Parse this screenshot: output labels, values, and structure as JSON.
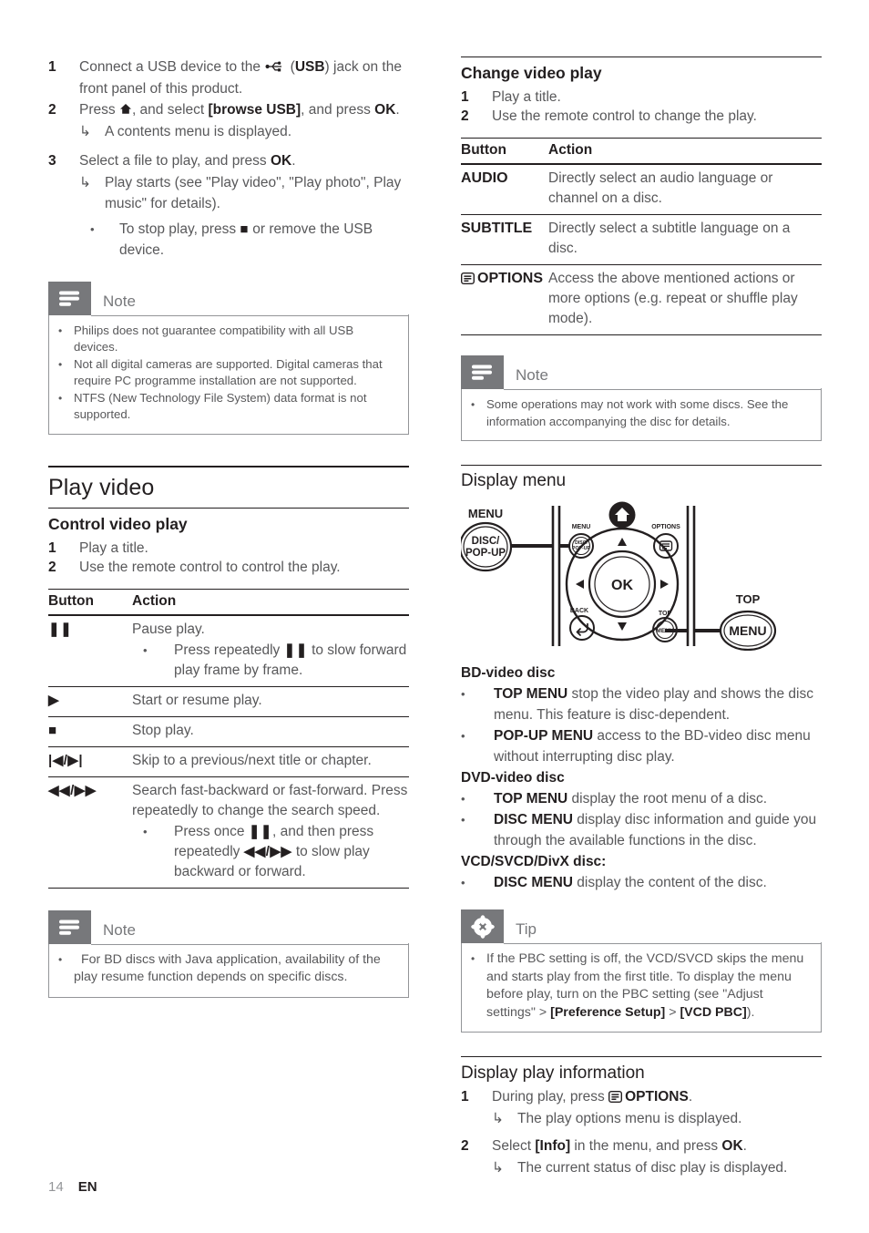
{
  "footer": {
    "page_number": "14",
    "language": "EN"
  },
  "left_column": {
    "usb_steps": [
      {
        "num": "1",
        "text_before": "Connect a USB device to the ",
        "icon": "usb-icon",
        "text_mid": " (",
        "bold": "USB",
        "text_after": ") jack on the front panel of this product."
      },
      {
        "num": "2",
        "text_before": "Press ",
        "icon": "home-icon",
        "text_mid": ", and select ",
        "bold": "[browse USB]",
        "text_after": ", and press ",
        "bold2": "OK",
        "text_end": ".",
        "arrow_note": "A contents menu is displayed."
      },
      {
        "num": "3",
        "text_before": "Select a file to play, and press ",
        "bold": "OK",
        "text_end": ".",
        "arrow_note": "Play starts (see \"Play video\", \"Play photo\", Play music\" for details).",
        "dot_note_before": "To stop play, press ",
        "dot_note_icon": "stop-icon",
        "dot_note_after": " or remove the USB device."
      }
    ],
    "note_usb": {
      "title": "Note",
      "icon": "note-icon",
      "items": [
        "Philips does not guarantee compatibility with all USB devices.",
        "Not all digital cameras are supported. Digital cameras that require PC programme installation are not supported.",
        "NTFS (New Technology File System) data format is not supported."
      ]
    },
    "play_video_heading": "Play video",
    "control_video_play": {
      "heading": "Control video play",
      "steps": [
        {
          "num": "1",
          "text": "Play a title."
        },
        {
          "num": "2",
          "text": "Use the remote control to control the play."
        }
      ]
    },
    "control_table": {
      "headers": [
        "Button",
        "Action"
      ],
      "rows": [
        {
          "button_icon": "pause-icon",
          "button_glyph": "❚❚",
          "action": "Pause play.",
          "sub_before": "Press repeatedly ",
          "sub_glyph": "❚❚",
          "sub_after": " to slow forward play frame by frame."
        },
        {
          "button_icon": "play-icon",
          "button_glyph": "▶",
          "action": "Start or resume play."
        },
        {
          "button_icon": "stop-icon",
          "button_glyph": "■",
          "action": "Stop play."
        },
        {
          "button_icon": "skip-prev-next-icon",
          "button_glyph": "|◀/▶|",
          "action": "Skip to a previous/next title or chapter."
        },
        {
          "button_icon": "rewind-forward-icon",
          "button_glyph": "◀◀/▶▶",
          "action": "Search fast-backward or fast-forward. Press repeatedly to change the search speed.",
          "sub_before": "Press once ",
          "sub_glyph": "❚❚",
          "sub_mid": ", and then press repeatedly ",
          "sub_glyph2": "◀◀/▶▶",
          "sub_after": " to slow play backward or forward."
        }
      ]
    },
    "note_bd": {
      "title": "Note",
      "icon": "note-icon",
      "items": [
        "For BD discs with Java application, availability of the play resume function depends on specific discs."
      ]
    }
  },
  "right_column": {
    "change_video_play": {
      "heading": "Change video play",
      "steps": [
        {
          "num": "1",
          "text": "Play a title."
        },
        {
          "num": "2",
          "text": "Use the remote control to change the play."
        }
      ]
    },
    "change_table": {
      "headers": [
        "Button",
        "Action"
      ],
      "rows": [
        {
          "button": "AUDIO",
          "action": "Directly select an audio language or channel on a disc."
        },
        {
          "button": "SUBTITLE",
          "action": "Directly select a subtitle language on a disc."
        },
        {
          "button_icon": "options-icon",
          "button": "OPTIONS",
          "action": "Access the above mentioned actions or more options (e.g. repeat or shuffle play mode)."
        }
      ]
    },
    "note_operations": {
      "title": "Note",
      "icon": "note-icon",
      "items": [
        "Some operations may not work with some discs. See the information accompanying the disc for details."
      ]
    },
    "display_menu_heading": "Display menu",
    "remote_diagram": {
      "label_menu": "MENU",
      "label_disc_popup_line1": "DISC/",
      "label_disc_popup_line2": "POP-UP",
      "label_top": "TOP",
      "label_menu_button": "MENU",
      "inner_menu": "MENU",
      "inner_disc1": "DISC/",
      "inner_disc2": "POP-UP",
      "inner_options": "OPTIONS",
      "inner_ok": "OK",
      "inner_back": "BACK",
      "inner_top": "TOP",
      "inner_top_menu": "MENU",
      "icon_home": "home-icon",
      "icon_options": "options-icon",
      "icon_back": "back-arrow-icon"
    },
    "disc_sections": [
      {
        "heading": "BD-video disc",
        "items": [
          {
            "bold": "TOP MENU",
            "text": " stop the video play and shows the disc menu. This feature is disc-dependent."
          },
          {
            "bold": "POP-UP MENU",
            "text": " access to the BD-video disc menu without interrupting disc play."
          }
        ]
      },
      {
        "heading": "DVD-video disc",
        "items": [
          {
            "bold": "TOP MENU",
            "text": " display the root menu of a disc."
          },
          {
            "bold": "DISC MENU",
            "text": " display disc information and guide you through the available functions in the disc."
          }
        ]
      },
      {
        "heading": "VCD/SVCD/DivX disc:",
        "items": [
          {
            "bold": "DISC MENU",
            "text": " display the content of the disc."
          }
        ]
      }
    ],
    "tip_pbc": {
      "title": "Tip",
      "icon": "tip-icon",
      "text_a": "If the PBC setting is off, the VCD/SVCD skips the menu and starts play from the first title. To display the menu before play, turn on the PBC setting (see \"Adjust settings\" > ",
      "bold_b": "[Preference Setup]",
      "text_c": " > ",
      "bold_d": "[VCD PBC]",
      "text_e": ")."
    },
    "display_play_information": {
      "heading": "Display play information",
      "steps": [
        {
          "num": "1",
          "text_before": "During play, press ",
          "icon": "options-icon",
          "bold": "OPTIONS",
          "text_end": ".",
          "arrow_note": "The play options menu is displayed."
        },
        {
          "num": "2",
          "text_before": "Select ",
          "bold": "[Info]",
          "text_mid": " in the menu, and press ",
          "bold2": "OK",
          "text_end": ".",
          "arrow_note": "The current status of disc play is displayed."
        }
      ]
    }
  },
  "colors": {
    "body_text": "#58585a",
    "heading_text": "#231f20",
    "callout_badge": "#77787b",
    "callout_border": "#939598",
    "page_number": "#939598"
  }
}
